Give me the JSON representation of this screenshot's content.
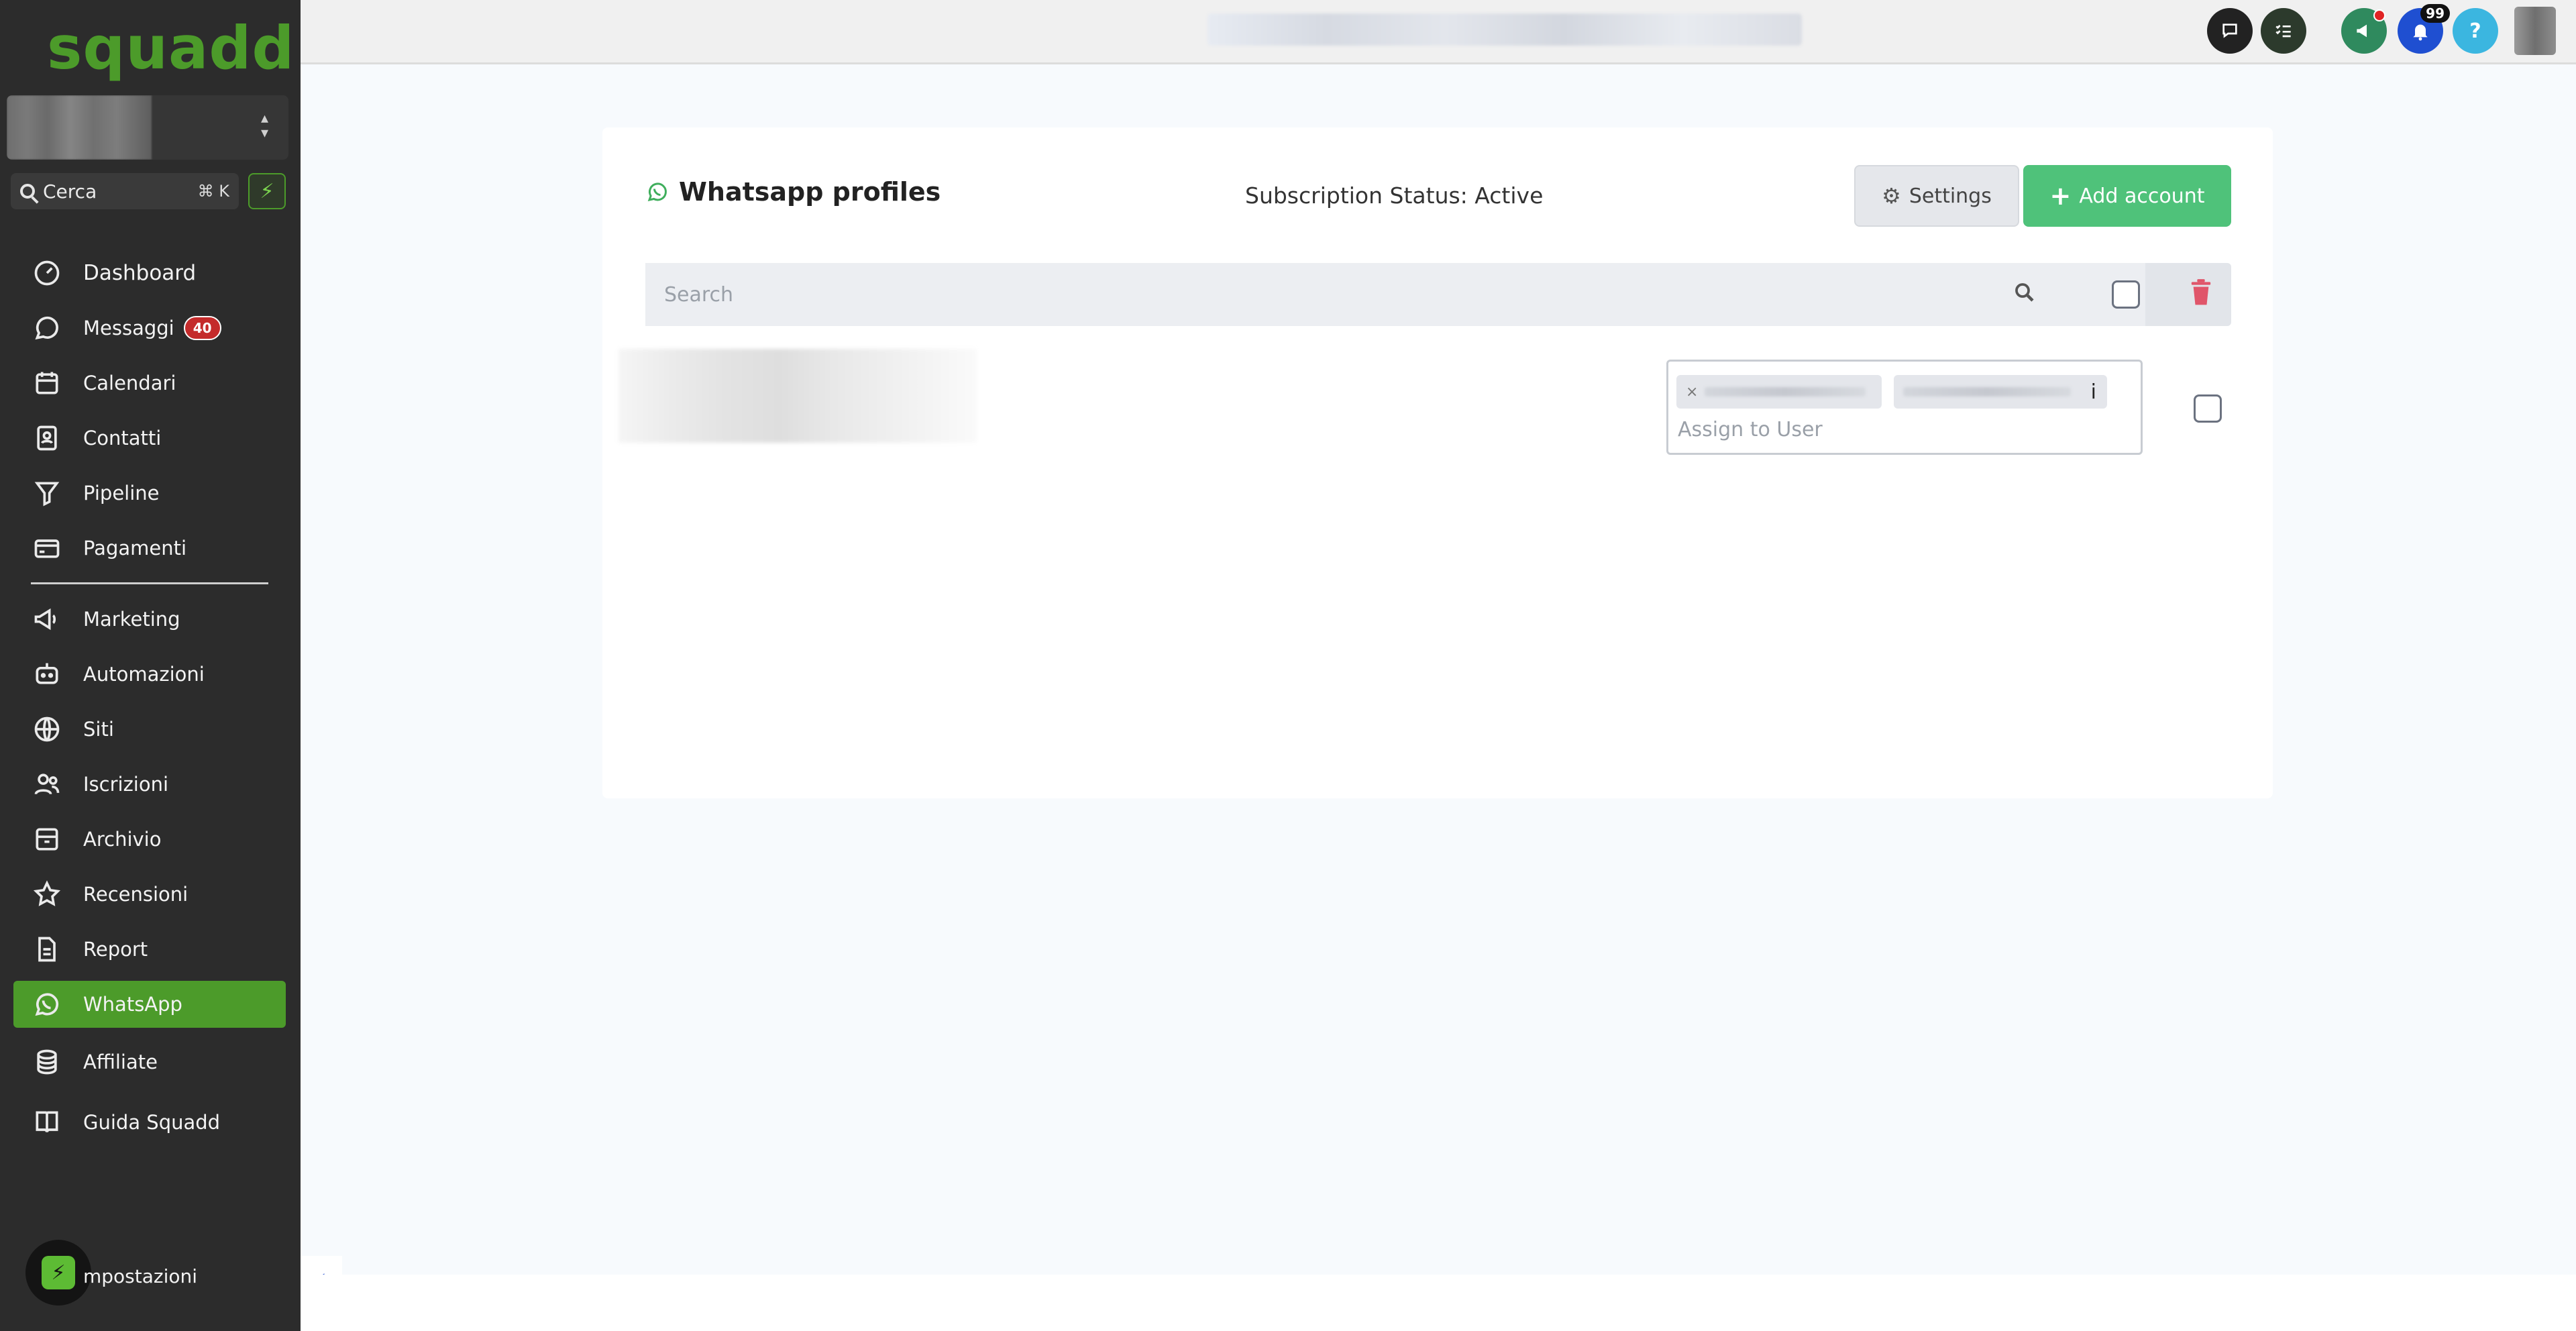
{
  "app": {
    "logo": "squadd"
  },
  "sidebar": {
    "search_label": "Cerca",
    "search_shortcut": "⌘ K",
    "items": [
      {
        "label": "Dashboard",
        "icon": "dashboard-icon"
      },
      {
        "label": "Messaggi",
        "icon": "chat-icon",
        "badge": "40"
      },
      {
        "label": "Calendari",
        "icon": "calendar-icon"
      },
      {
        "label": "Contatti",
        "icon": "contacts-icon"
      },
      {
        "label": "Pipeline",
        "icon": "funnel-icon"
      },
      {
        "label": "Pagamenti",
        "icon": "credit-card-icon"
      },
      {
        "label": "Marketing",
        "icon": "megaphone-icon"
      },
      {
        "label": "Automazioni",
        "icon": "robot-icon"
      },
      {
        "label": "Siti",
        "icon": "globe-icon"
      },
      {
        "label": "Iscrizioni",
        "icon": "users-icon"
      },
      {
        "label": "Archivio",
        "icon": "archive-icon"
      },
      {
        "label": "Recensioni",
        "icon": "star-icon"
      },
      {
        "label": "Report",
        "icon": "report-icon"
      },
      {
        "label": "WhatsApp",
        "icon": "whatsapp-icon",
        "active": true
      },
      {
        "label": "Affiliate",
        "icon": "coins-icon"
      },
      {
        "label": "Guida Squadd",
        "icon": "book-icon"
      }
    ],
    "settings_label": "mpostazioni"
  },
  "topbar": {
    "notifications_count": "99",
    "help_label": "?"
  },
  "main": {
    "title": "Whatsapp profiles",
    "subscription_status": "Subscription Status: Active",
    "settings_button": "Settings",
    "add_account_button": "Add account",
    "search_placeholder": "Search",
    "assign_placeholder": "Assign to User",
    "chip_info": "i",
    "chip_remove": "×"
  },
  "colors": {
    "brand_green": "#4c9b2a",
    "add_button": "#4fc27a",
    "sidebar_bg": "#2c2c2c",
    "danger": "#e0556a"
  }
}
